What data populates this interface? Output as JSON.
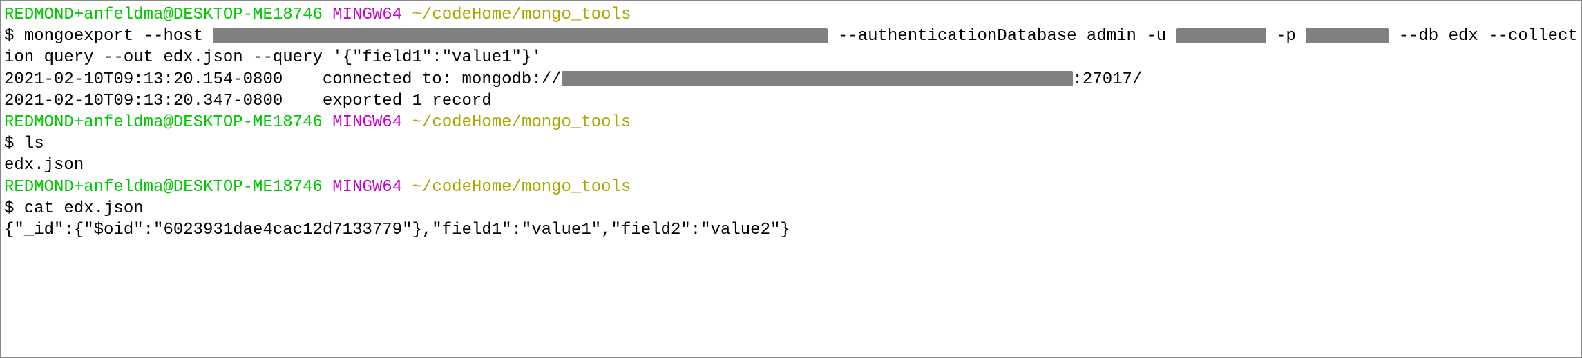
{
  "prompts": [
    {
      "user": "REDMOND+anfeldma@DESKTOP-ME18746",
      "env": "MINGW64",
      "path": "~/codeHome/mongo_tools"
    },
    {
      "user": "REDMOND+anfeldma@DESKTOP-ME18746",
      "env": "MINGW64",
      "path": "~/codeHome/mongo_tools"
    },
    {
      "user": "REDMOND+anfeldma@DESKTOP-ME18746",
      "env": "MINGW64",
      "path": "~/codeHome/mongo_tools"
    }
  ],
  "cmd1": {
    "dollar": "$ ",
    "part1": "mongoexport --host ",
    "part2": " --authenticationDatabase admin -u ",
    "part3": "-p ",
    "part4": " --db edx --collection query --out edx.json --query '{\"field1\":\"value1\"}'"
  },
  "output1": {
    "line1_ts": "2021-02-10T09:13:20.154-0800",
    "line1_pad": "    ",
    "line1_text": "connected to: mongodb://",
    "line1_tail": ":27017/",
    "line2_ts": "2021-02-10T09:13:20.347-0800",
    "line2_pad": "    ",
    "line2_text": "exported 1 record"
  },
  "cmd2": {
    "dollar": "$ ",
    "text": "ls"
  },
  "output2": {
    "line1": "edx.json"
  },
  "cmd3": {
    "dollar": "$ ",
    "text": "cat edx.json"
  },
  "output3": {
    "line1": "{\"_id\":{\"$oid\":\"6023931dae4cac12d7133779\"},\"field1\":\"value1\",\"field2\":\"value2\"}"
  }
}
